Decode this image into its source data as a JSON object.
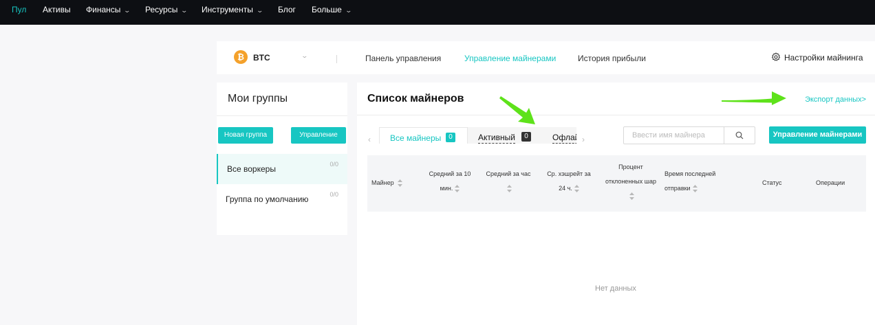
{
  "topnav": {
    "items": [
      {
        "label": "Пул",
        "active": true,
        "dropdown": false
      },
      {
        "label": "Активы",
        "active": false,
        "dropdown": false
      },
      {
        "label": "Финансы",
        "active": false,
        "dropdown": true
      },
      {
        "label": "Ресурсы",
        "active": false,
        "dropdown": true
      },
      {
        "label": "Инструменты",
        "active": false,
        "dropdown": true
      },
      {
        "label": "Блог",
        "active": false,
        "dropdown": false
      },
      {
        "label": "Больше",
        "active": false,
        "dropdown": true
      }
    ]
  },
  "header": {
    "coin": {
      "symbol": "₿",
      "label": "BTC",
      "icon": "bitcoin-icon",
      "color": "#f4a12b"
    },
    "tabs": [
      {
        "label": "Панель управления",
        "active": false
      },
      {
        "label": "Управление майнерами",
        "active": true
      },
      {
        "label": "История прибыли",
        "active": false
      }
    ],
    "settings_label": "Настройки майнинга"
  },
  "groups": {
    "title": "Мои группы",
    "new_group_label": "Новая группа",
    "manage_label": "Управление",
    "items": [
      {
        "name": "Все воркеры",
        "count": "0/0",
        "active": true
      },
      {
        "name": "Группа по умолчанию",
        "count": "0/0",
        "active": false
      }
    ]
  },
  "miners": {
    "title": "Список майнеров",
    "export_label": "Экспорт данных>",
    "tabs": [
      {
        "label": "Все майнеры",
        "count": "0",
        "active": true
      },
      {
        "label": "Активный",
        "count": "0",
        "active": false
      },
      {
        "label": "Офлайн",
        "count": "",
        "active": false
      }
    ],
    "search_placeholder": "Ввести имя майнера",
    "manage_button": "Управление майнерами",
    "columns": {
      "miner": "Майнер",
      "avg10_line1": "Средний за 10",
      "avg10_line2": "мин.",
      "avg_hour": "Средний за час",
      "avg24_line1": "Ср. хэшрейт за",
      "avg24_line2": "24 ч.",
      "reject_line1": "Процент",
      "reject_line2": "отклоненных шар",
      "last_line1": "Время последней",
      "last_line2": "отправки",
      "status": "Статус",
      "operations": "Операции"
    },
    "empty_text": "Нет данных"
  },
  "colors": {
    "accent": "#17c6c2",
    "topbar": "#0d0f13",
    "annotation_arrow": "#5ee21a"
  }
}
